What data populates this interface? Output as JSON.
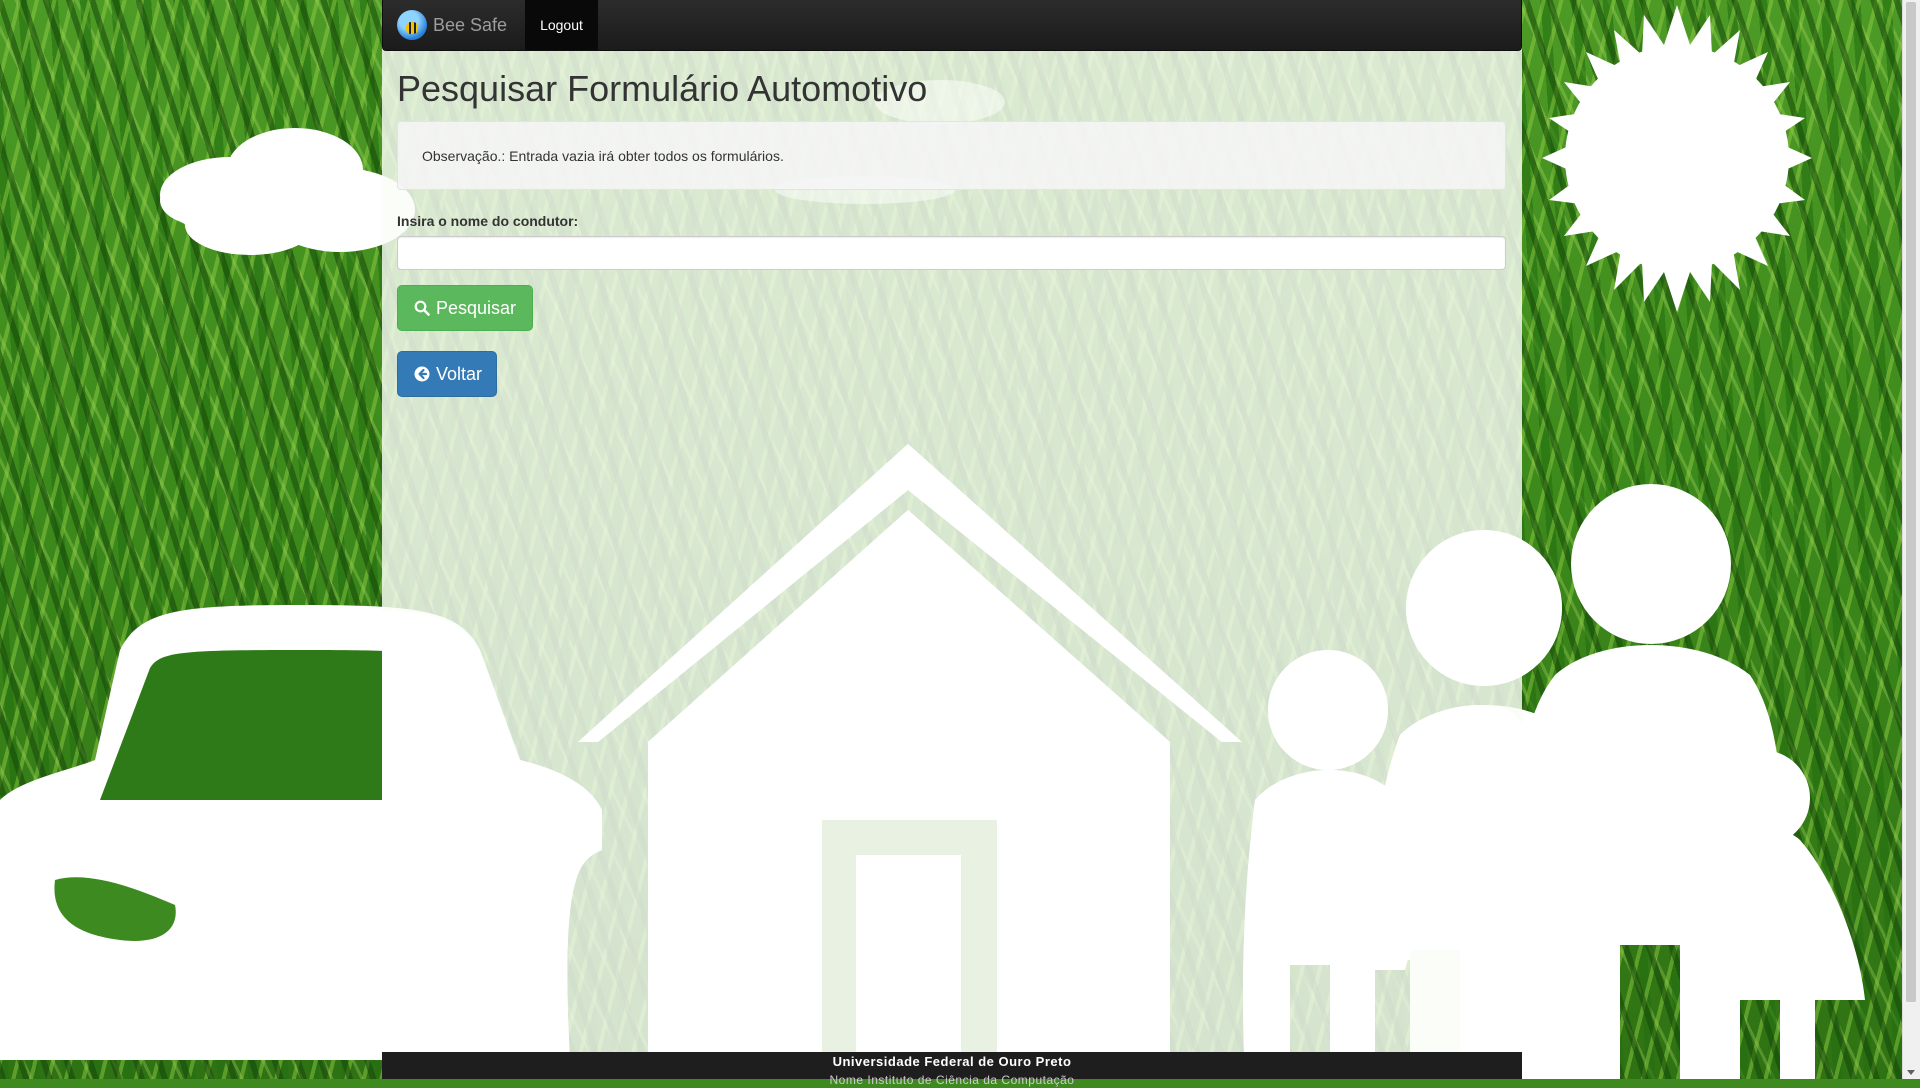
{
  "navbar": {
    "brand": "Bee Safe",
    "logout": "Logout"
  },
  "page": {
    "title": "Pesquisar Formulário Automotivo",
    "note": "Observação.: Entrada vazia irá obter todos os formulários.",
    "field_label": "Insira o nome do condutor:",
    "field_value": "",
    "search_button": "Pesquisar",
    "back_button": "Voltar"
  },
  "footer": {
    "institution": "Universidade Federal de Ouro Preto",
    "subline": "Nome Instituto de Ciência da Computação"
  },
  "icons": {
    "brand": "bee-logo-icon",
    "search": "search-icon",
    "back": "arrow-circle-left-icon"
  },
  "colors": {
    "navbar": "#1b1b1b",
    "success": "#5cb85c",
    "primary": "#337ab7",
    "grass": "#3f8a1f"
  }
}
